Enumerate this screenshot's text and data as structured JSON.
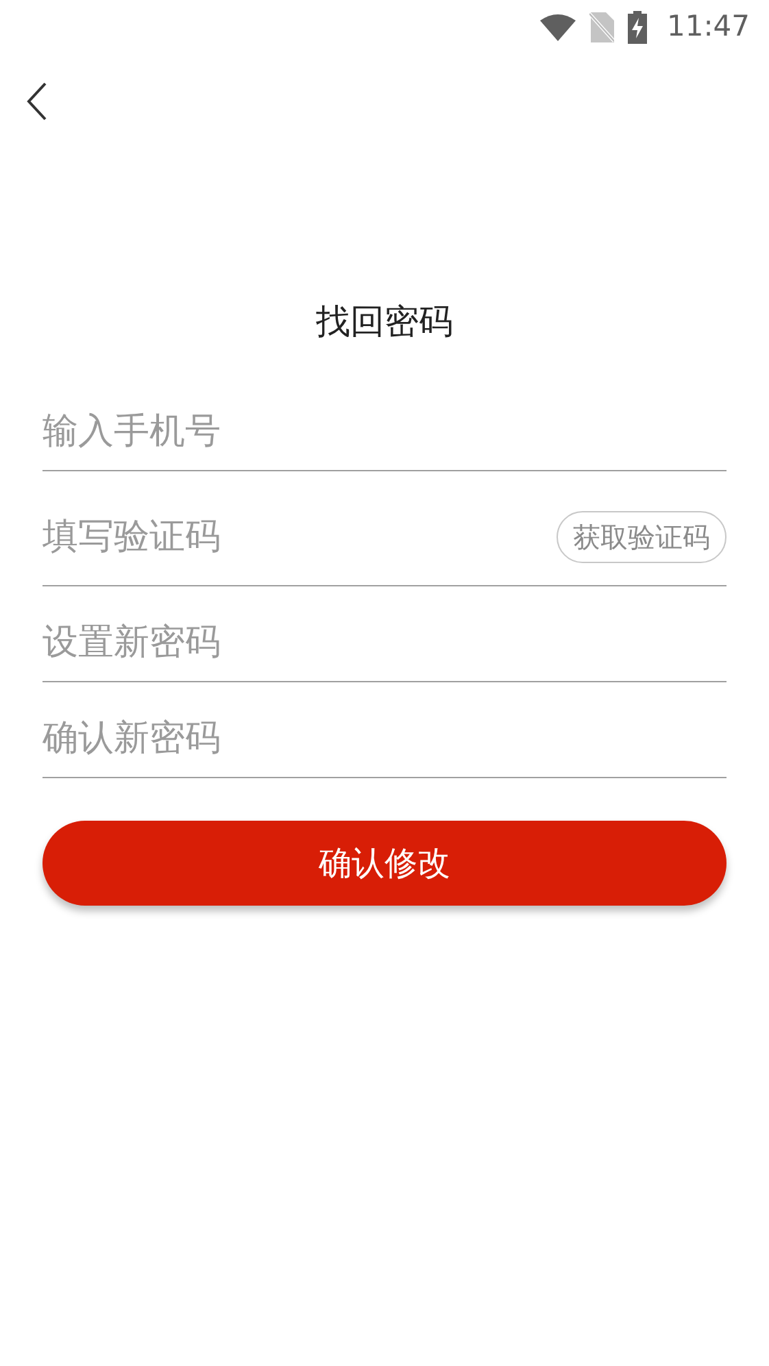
{
  "status_bar": {
    "time": "11:47"
  },
  "title": "找回密码",
  "fields": [
    {
      "kind": "plain",
      "placeholder": "输入手机号"
    },
    {
      "kind": "with_button",
      "placeholder": "填写验证码",
      "button": "获取验证码"
    },
    {
      "kind": "plain",
      "placeholder": "设置新密码"
    },
    {
      "kind": "plain",
      "placeholder": "确认新密码"
    }
  ],
  "submit_button": "确认修改"
}
